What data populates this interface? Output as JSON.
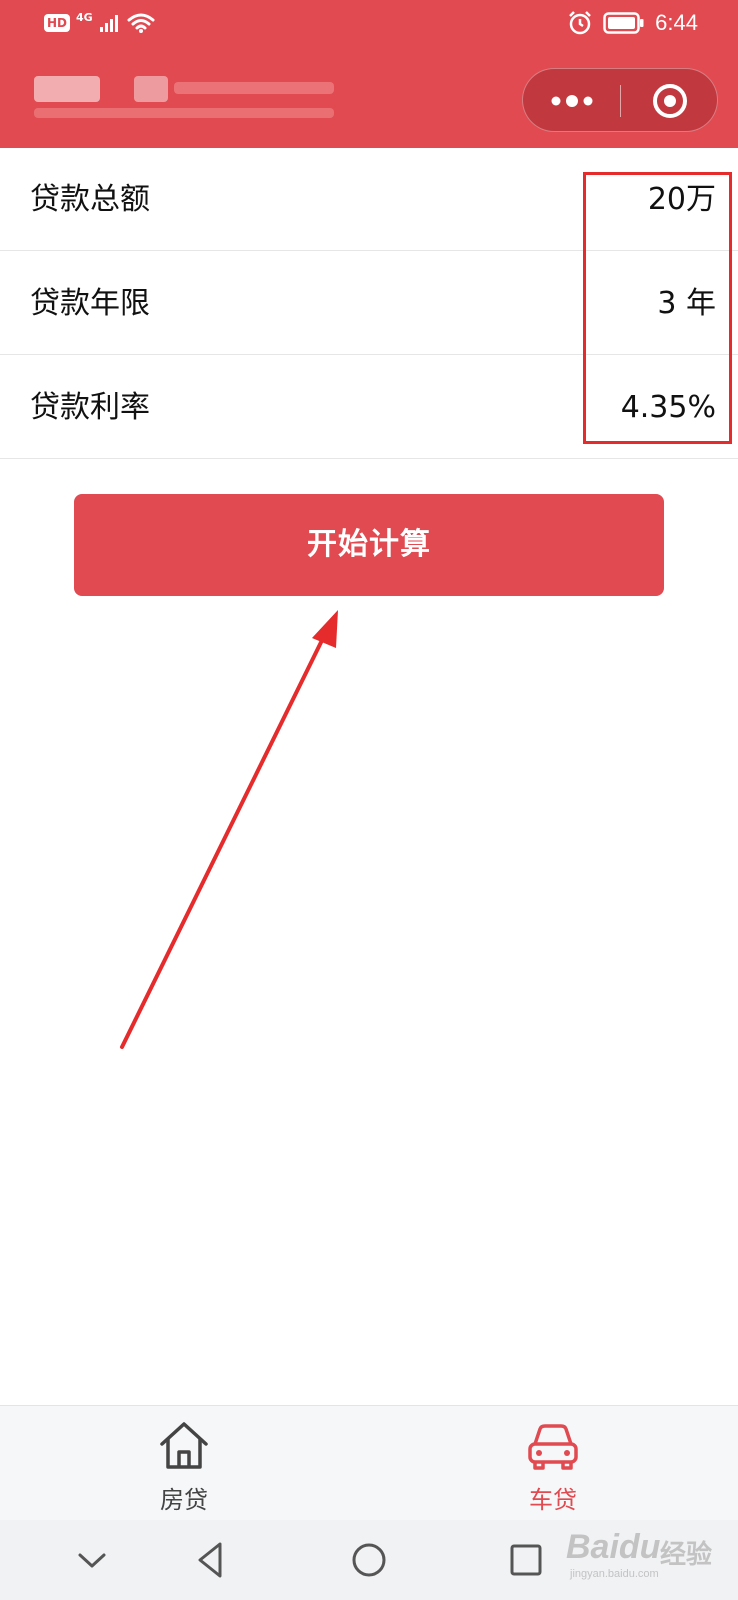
{
  "status_bar": {
    "hd": "HD",
    "network": "4G",
    "time": "6:44"
  },
  "form": {
    "rows": [
      {
        "label": "贷款总额",
        "value": "20万"
      },
      {
        "label": "贷款年限",
        "value": "3 年"
      },
      {
        "label": "贷款利率",
        "value": "4.35%"
      }
    ]
  },
  "calculate_button": {
    "label": "开始计算"
  },
  "tabbar": {
    "tabs": [
      {
        "label": "房贷",
        "icon": "house-icon",
        "active": false,
        "color": "#444444"
      },
      {
        "label": "车贷",
        "icon": "car-icon",
        "active": true,
        "color": "#e04a50"
      }
    ]
  },
  "colors": {
    "brand": "#e04a50",
    "annotation": "#e52b2b"
  },
  "watermark": {
    "brand": "Baidu",
    "cn": "经验",
    "url": "jingyan.baidu.com"
  }
}
